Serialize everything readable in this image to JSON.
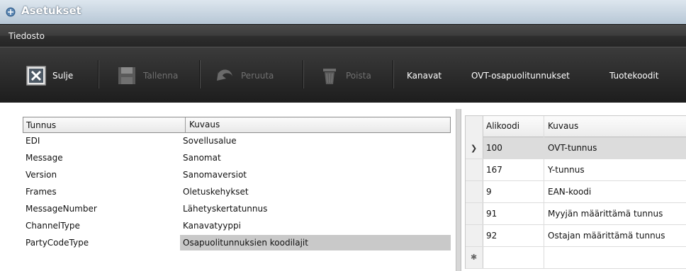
{
  "window": {
    "title": "Asetukset"
  },
  "menu": {
    "items": [
      "Tiedosto"
    ]
  },
  "toolbar": {
    "close": "Sulje",
    "save": "Tallenna",
    "undo": "Peruuta",
    "delete": "Poista",
    "channels": "Kanavat",
    "ovt": "OVT-osapuolitunnukset",
    "product_codes": "Tuotekoodit"
  },
  "left_table": {
    "headers": [
      "Tunnus",
      "Kuvaus"
    ],
    "rows": [
      [
        "EDI",
        "Sovellusalue"
      ],
      [
        "Message",
        "Sanomat"
      ],
      [
        "Version",
        "Sanomaversiot"
      ],
      [
        "Frames",
        "Oletuskehykset"
      ],
      [
        "MessageNumber",
        "Lähetyskertatunnus"
      ],
      [
        "ChannelType",
        "Kanavatyyppi"
      ],
      [
        "PartyCodeType",
        "Osapuolitunnuksien koodilajit"
      ]
    ]
  },
  "right_table": {
    "headers": [
      "Alikoodi",
      "Kuvaus"
    ],
    "rows": [
      [
        "100",
        "OVT-tunnus"
      ],
      [
        "167",
        "Y-tunnus"
      ],
      [
        "9",
        "EAN-koodi"
      ],
      [
        "91",
        "Myyjän määrittämä tunnus"
      ],
      [
        "92",
        "Ostajan määrittämä tunnus"
      ]
    ]
  },
  "colors": {
    "toolbar_bg": "#2b2b2b",
    "selected_row": "#c9c9c9"
  }
}
